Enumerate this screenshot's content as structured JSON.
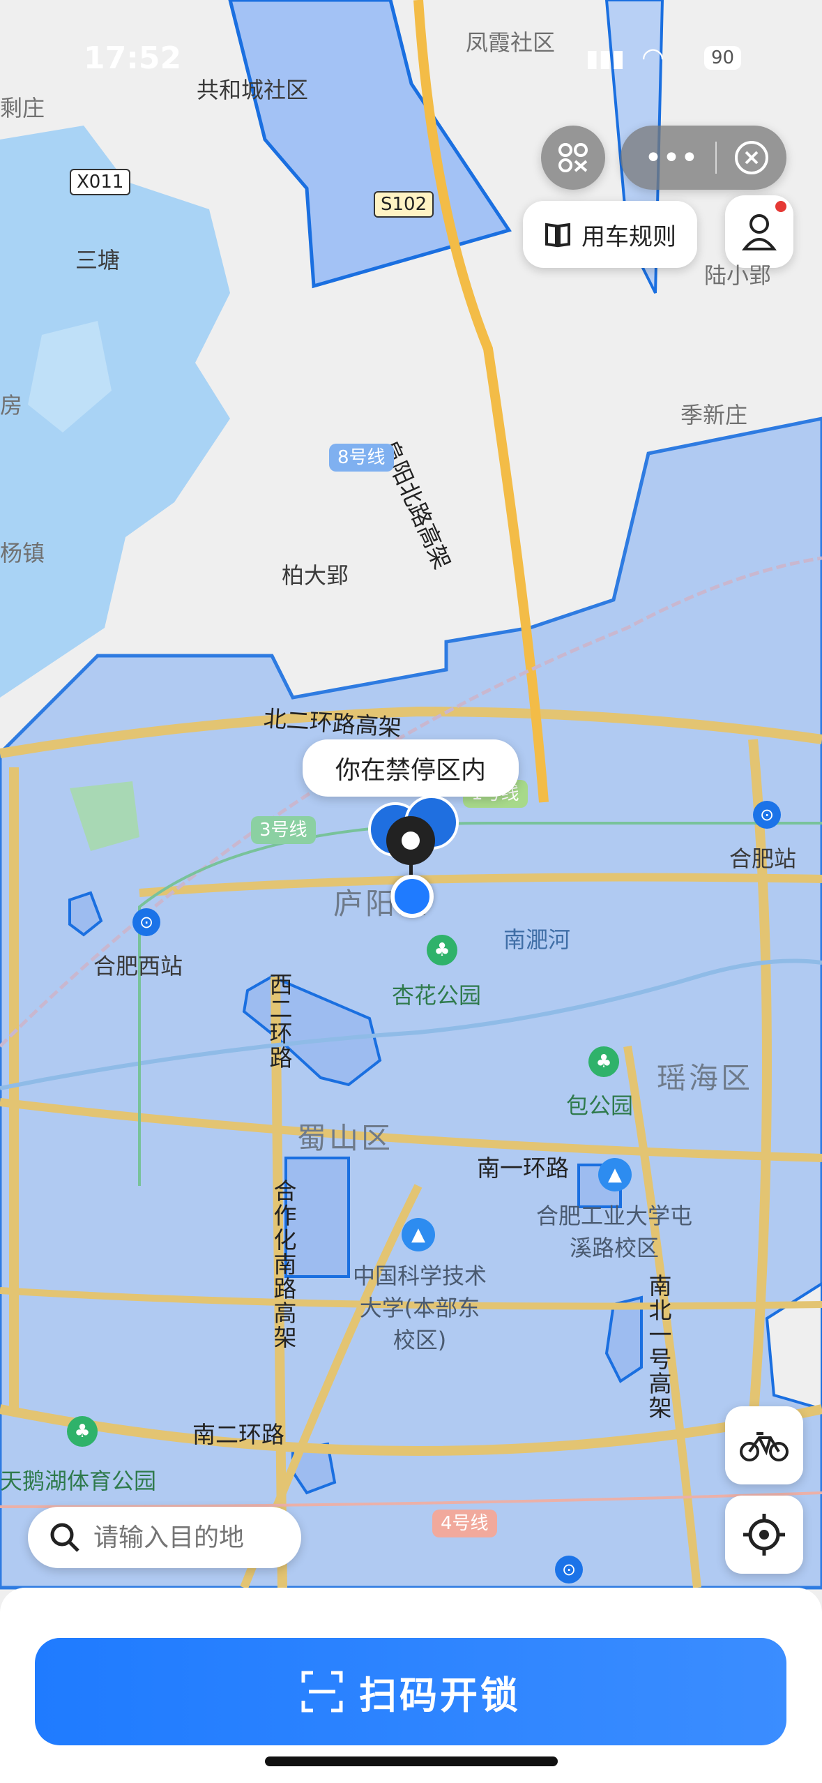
{
  "status_bar": {
    "time": "17:52",
    "battery": "90"
  },
  "top_controls": {
    "rules_label": "用车规则"
  },
  "map": {
    "place_labels": [
      "凤霞社区",
      "共和城社区",
      "三塘",
      "陆小郢",
      "季新庄",
      "柏大郢",
      "杨镇",
      "剩庄",
      "房"
    ],
    "district_labels": [
      "庐阳区",
      "蜀山区",
      "瑶海区"
    ],
    "road_labels": [
      "北二环路高架",
      "阜阳北路高架",
      "南一环路",
      "南二环路",
      "西二环路",
      "合作化南路高架",
      "南北一号高架",
      "南淝河"
    ],
    "road_badges": [
      "X011",
      "S102"
    ],
    "metro_lines": [
      "8号线",
      "3号线",
      "4号线",
      "1号线"
    ],
    "pois": [
      "合肥西站",
      "合肥站",
      "杏花公园",
      "包公园",
      "合肥工业大学屯溪路校区",
      "中国科学技术大学(本部东校区)",
      "天鹅湖体育公园"
    ],
    "callout": "你在禁停区内",
    "colors": {
      "parking_zone_fill": "#a9c6f5",
      "zone_border": "#1a6fe0",
      "water": "#a9d3f5",
      "accent": "#1f7bff"
    }
  },
  "search": {
    "placeholder": "请输入目的地"
  },
  "actions": {
    "scan_label": "扫码开锁"
  }
}
